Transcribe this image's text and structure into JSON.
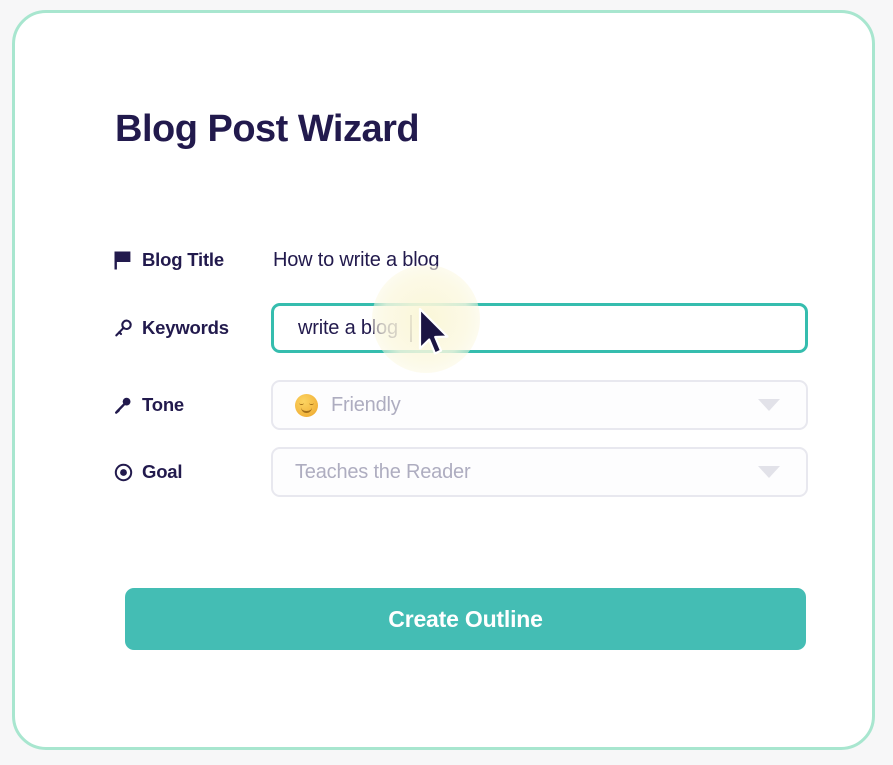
{
  "page": {
    "title": "Blog Post Wizard",
    "accent_teal": "#44bdb4",
    "border_mint": "#a8e6cf",
    "text_navy": "#221a4d",
    "placeholder_gray": "#aeadc0",
    "focus_border": "#35bdae"
  },
  "fields": [
    {
      "id": "blog-title",
      "icon": "flag-icon",
      "label": "Blog Title",
      "type": "static",
      "value": "How to write a blog"
    },
    {
      "id": "keywords",
      "icon": "key-icon",
      "label": "Keywords",
      "type": "text",
      "value": "write a blog",
      "focused": true
    },
    {
      "id": "tone",
      "icon": "microphone-icon",
      "label": "Tone",
      "type": "select",
      "emoji": "smiling-face-emoji",
      "value": "Friendly",
      "arrow": "chevron-down-icon"
    },
    {
      "id": "goal",
      "icon": "target-icon",
      "label": "Goal",
      "type": "select",
      "value": "Teaches the Reader",
      "arrow": "chevron-down-icon"
    }
  ],
  "submit": {
    "label": "Create Outline"
  },
  "cursor": {
    "icon": "mouse-pointer-icon",
    "glow": "click-highlight"
  }
}
